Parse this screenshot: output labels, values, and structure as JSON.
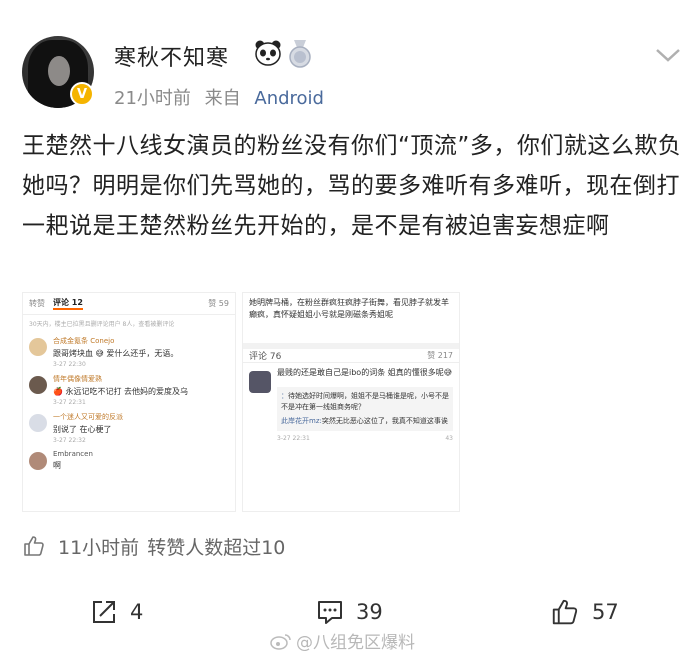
{
  "post": {
    "username": "寒秋不知寒",
    "time": "21小时前",
    "from_label": "来自",
    "source": "Android",
    "verified_badge": "V",
    "icons": [
      "panda-emoji-icon",
      "medal-icon",
      "chevron-down-icon"
    ],
    "content": "王楚然十八线女演员的粉丝没有你们“顶流”多，你们就这么欺负她吗？明明是你们先骂她的，骂的要多难听有多难听，现在倒打一耙说是王楚然粉丝先开始的，是不是有被迫害妄想症啊"
  },
  "screenshot1": {
    "tab_forward": "转赞",
    "tab_comments": "评论 12",
    "tab_likes": "赞 59",
    "note": "30天内，楼主已拉黑且删评论用户 8人，查看被删评论",
    "comments": [
      {
        "name": "合成金氪条 Conejo",
        "text": "跟哥烤块血 😅 爱什么还乎，无语。",
        "time": "3-27 22:30"
      },
      {
        "name": "情年偶像情爱熟",
        "text": "🍎 永远记吃不记打 去他妈的爱度及乌",
        "time": "3-27 22:31"
      },
      {
        "name": "一个迷人又可爱的反派",
        "text": "别说了 在心梗了",
        "time": "3-27 22:32"
      },
      {
        "name": "Embrancen",
        "text": "啊",
        "time": ""
      }
    ]
  },
  "screenshot2": {
    "top_text": "她明牌马桶，在粉丝群疯狂疯脖子街舞，看见脖子就发羊癫疯，真怀疑姐姐小号就是刚磁条秀姐呢",
    "tab_comments": "评论 76",
    "tab_likes": "赞 217",
    "comment_text": "最贱的还是敢自己是ibo的词条 姐真的懂很多呢😅",
    "reply_name": "：",
    "reply_text": "待她选好时间爆啊，姐姐不是马桶谁是呢，小号不是不是冲在第一线姐商务呢？",
    "reply_name2": "此岸花开mz:",
    "reply_text2": "突然无比恶心这位了，我真不知道这事诶",
    "time": "3-27 22:31",
    "likes": "43"
  },
  "stats": {
    "like_time": "11小时前",
    "like_text": "转赞人数超过10"
  },
  "actions": {
    "repost_count": "4",
    "comment_count": "39",
    "like_count": "57"
  },
  "watermark": "@八组免区爆料"
}
